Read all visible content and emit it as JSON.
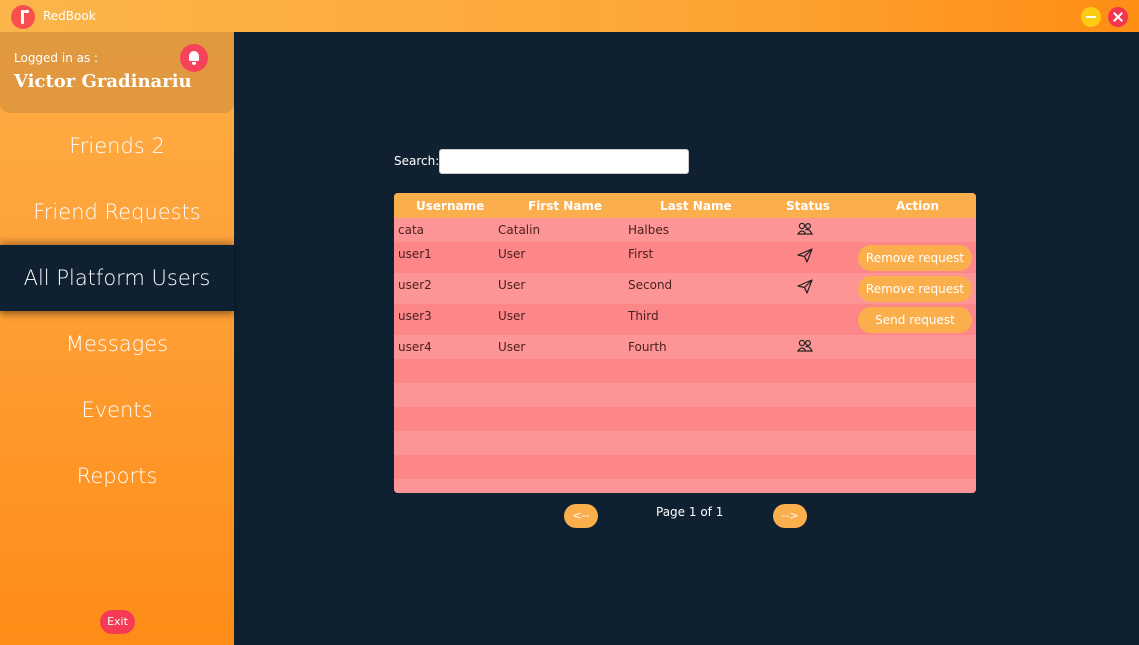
{
  "window": {
    "title": "RedBook"
  },
  "sidebar": {
    "logged_label": "Logged in as :",
    "user_name": "Victor Gradinariu",
    "items": [
      {
        "label": "Friends 2"
      },
      {
        "label": "Friend Requests"
      },
      {
        "label": "All Platform Users"
      },
      {
        "label": "Messages"
      },
      {
        "label": "Events"
      },
      {
        "label": "Reports"
      }
    ],
    "active_index": 2,
    "exit_label": "Exit"
  },
  "search": {
    "label": "Search:",
    "value": "",
    "placeholder": ""
  },
  "table": {
    "columns": [
      "Username",
      "First Name",
      "Last Name",
      "Status",
      "Action"
    ],
    "rows": [
      {
        "username": "cata",
        "first": "Catalin",
        "last": "Halbes",
        "status_icon": "friends-icon",
        "action": ""
      },
      {
        "username": "user1",
        "first": "User",
        "last": "First",
        "status_icon": "sent-request-icon",
        "action": "Remove request"
      },
      {
        "username": "user2",
        "first": "User",
        "last": "Second",
        "status_icon": "sent-request-icon",
        "action": "Remove request"
      },
      {
        "username": "user3",
        "first": "User",
        "last": "Third",
        "status_icon": "",
        "action": "Send request"
      },
      {
        "username": "user4",
        "first": "User",
        "last": "Fourth",
        "status_icon": "friends-icon",
        "action": ""
      }
    ]
  },
  "pager": {
    "prev_label": "<--",
    "next_label": "-->",
    "page_text": "Page 1 of 1"
  },
  "colors": {
    "accent": "#fbae4c",
    "background": "#0f2130",
    "row": "#fd8d8f",
    "danger": "#f43a55"
  }
}
